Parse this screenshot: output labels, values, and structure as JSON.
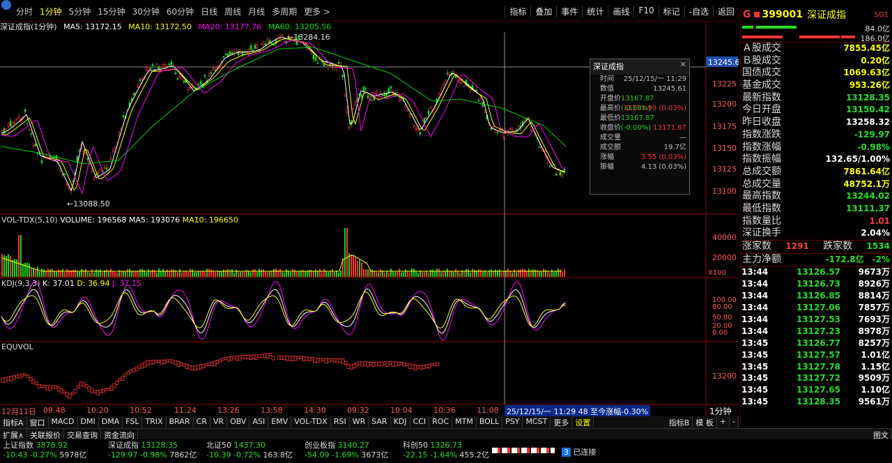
{
  "toolbar": {
    "periods": [
      "分时",
      "1分钟",
      "5分钟",
      "15分钟",
      "30分钟",
      "60分钟",
      "日线",
      "周线",
      "月线",
      "多周期",
      "更多 >"
    ],
    "active_period": "1分钟",
    "tools": [
      "指标",
      "叠加",
      "事件",
      "统计",
      "画线",
      "F10",
      "标记",
      "-自选",
      "返回"
    ]
  },
  "chart_header": {
    "name": "深证成指(1分钟)",
    "ma5": "MA5: 13172.15",
    "ma10": "MA10: 13172.50",
    "ma20": "MA20: 13177.76",
    "ma60": "MA60: 13205.56"
  },
  "price_panel": {
    "high_label": "13284.16",
    "low_label": "13088.50",
    "crosshair_price": "13245.6",
    "axis": [
      "13225",
      "13200",
      "13175",
      "13150",
      "13125",
      "13100"
    ]
  },
  "volume_panel": {
    "label": "VOL-TDX(5,10)",
    "volume": "VOLUME: 196568",
    "ma5": "MA5: 193076",
    "ma10": "MA10: 196650",
    "axis": [
      "40000",
      "20000"
    ],
    "unit": "X100"
  },
  "kdj_panel": {
    "label": "KDJ(9,3,3)",
    "k": "K: 37.01",
    "d": "D: 36.94",
    "j": "J: 37.15",
    "axis": [
      "100.00",
      "80.00",
      "50.00",
      "20.00",
      "0.00"
    ]
  },
  "equvol_panel": {
    "label": "EQUVOL",
    "axis": [
      "13200"
    ]
  },
  "time_axis": {
    "labels": [
      "12月11日",
      "09:48",
      "10:20",
      "10:52",
      "11:24",
      "13:26",
      "13:58",
      "14:30",
      "09:32",
      "10:04",
      "10:36",
      "11:08"
    ],
    "cursor_info": "25/12/15/一 11:29 48 至今涨幅-0.30%",
    "period": "1分钟"
  },
  "popup": {
    "title": "深证成指",
    "rows": [
      {
        "k": "时间",
        "v": "25/12/15/一 11:29",
        "c": ""
      },
      {
        "k": "数值",
        "v": "13245.61",
        "c": ""
      },
      {
        "k": "开盘价",
        "v": "13167.87 (-0.00%)",
        "c": "g"
      },
      {
        "k": "最高价",
        "v": "13171.99 (0.03%)",
        "c": "r"
      },
      {
        "k": "最低价",
        "v": "13167.87 (-0.00%)",
        "c": "g"
      },
      {
        "k": "收盘价",
        "v": "13171.67",
        "c": "r"
      },
      {
        "k": "成交量",
        "v": "—",
        "c": ""
      },
      {
        "k": "成交额",
        "v": "19.7亿",
        "c": ""
      },
      {
        "k": "涨幅",
        "v": "3.55 (0.03%)",
        "c": "r"
      },
      {
        "k": "振幅",
        "v": "4.13 (0.03%)",
        "c": ""
      }
    ]
  },
  "right_panel": {
    "code": "399001",
    "name": "深证成指",
    "tag": "SG1",
    "g": "G",
    "bar1": "84.0亿",
    "bar2": "186.0亿",
    "rows": [
      {
        "k": "Ａ股成交",
        "v": "7855.45亿",
        "c": "yellow"
      },
      {
        "k": "Ｂ股成交",
        "v": "0.20亿",
        "c": "yellow"
      },
      {
        "k": "国债成交",
        "v": "1069.63亿",
        "c": "yellow"
      },
      {
        "k": "基金成交",
        "v": "953.26亿",
        "c": "yellow"
      },
      {
        "k": "最新指数",
        "v": "13128.35",
        "c": "green"
      },
      {
        "k": "今日开盘",
        "v": "13150.42",
        "c": "green"
      },
      {
        "k": "昨日收盘",
        "v": "13258.32",
        "c": "white"
      },
      {
        "k": "指数涨跌",
        "v": "-129.97",
        "c": "green"
      },
      {
        "k": "指数涨幅",
        "v": "-0.98%",
        "c": "green"
      },
      {
        "k": "指数振幅",
        "v": "132.65/1.00%",
        "c": "white"
      },
      {
        "k": "总成交额",
        "v": "7861.64亿",
        "c": "yellow"
      },
      {
        "k": "总成交量",
        "v": "48752.1万",
        "c": "yellow"
      },
      {
        "k": "最高指数",
        "v": "13244.02",
        "c": "green"
      },
      {
        "k": "最低指数",
        "v": "13111.37",
        "c": "green"
      },
      {
        "k": "指数量比",
        "v": "1.01",
        "c": "red"
      },
      {
        "k": "深证换手",
        "v": "2.04%",
        "c": "white"
      }
    ],
    "rise_label": "涨家数",
    "rise": "1291",
    "fall_label": "跌家数",
    "fall": "1534",
    "main_label": "主力净额",
    "main_value": "-172.8亿",
    "main_pct": "-2%",
    "ticks": [
      {
        "t": "13:44",
        "p": "13126.57",
        "v": "9673万"
      },
      {
        "t": "13:44",
        "p": "13126.73",
        "v": "8926万"
      },
      {
        "t": "13:44",
        "p": "13126.85",
        "v": "8814万"
      },
      {
        "t": "13:44",
        "p": "13127.06",
        "v": "7857万"
      },
      {
        "t": "13:44",
        "p": "13127.53",
        "v": "7693万"
      },
      {
        "t": "13:44",
        "p": "13127.23",
        "v": "8978万"
      },
      {
        "t": "13:45",
        "p": "13126.77",
        "v": "8257万"
      },
      {
        "t": "13:45",
        "p": "13127.57",
        "v": "1.01亿"
      },
      {
        "t": "13:45",
        "p": "13127.78",
        "v": "1.15亿"
      },
      {
        "t": "13:45",
        "p": "13127.72",
        "v": "9509万"
      },
      {
        "t": "13:45",
        "p": "13127.65",
        "v": "1.10亿"
      },
      {
        "t": "13:45",
        "p": "13128.35",
        "v": "9561万"
      }
    ]
  },
  "indicator_tabs": [
    "指标A",
    "窗口",
    "MACD",
    "DMI",
    "DMA",
    "FSL",
    "TRIX",
    "BRAR",
    "CR",
    "VR",
    "OBV",
    "ASI",
    "EMV",
    "VOL-TDX",
    "RSI",
    "WR",
    "SAR",
    "KDJ",
    "CCI",
    "ROC",
    "MTM",
    "BOLL",
    "PSY",
    "MCST",
    "更多",
    "设置"
  ],
  "indicator_tabs_right": [
    "指标B",
    "模 板",
    "+",
    "-"
  ],
  "sub_tabs": [
    "扩展∧",
    "关联报价",
    "交易查询",
    "资金流向"
  ],
  "sub_right": "图文",
  "status_bar": [
    {
      "name": "上证指数",
      "price": "3878.92",
      "chg": "-10.43",
      "pct": "-0.27%",
      "amt": "5978亿"
    },
    {
      "name": "深证成指",
      "price": "13128.35",
      "chg": "-129.97",
      "pct": "-0.98%",
      "amt": "7862亿"
    },
    {
      "name": "北证50",
      "price": "1437.30",
      "chg": "-10.39",
      "pct": "-0.72%",
      "amt": "163.8亿"
    },
    {
      "name": "创业板指",
      "price": "3140.27",
      "chg": "-54.09",
      "pct": "-1.69%",
      "amt": "3673亿"
    },
    {
      "name": "科创50",
      "price": "1326.73",
      "chg": "-22.15",
      "pct": "-1.64%",
      "amt": "455.2亿"
    }
  ],
  "connection": "已连接",
  "connection_num": "3"
}
